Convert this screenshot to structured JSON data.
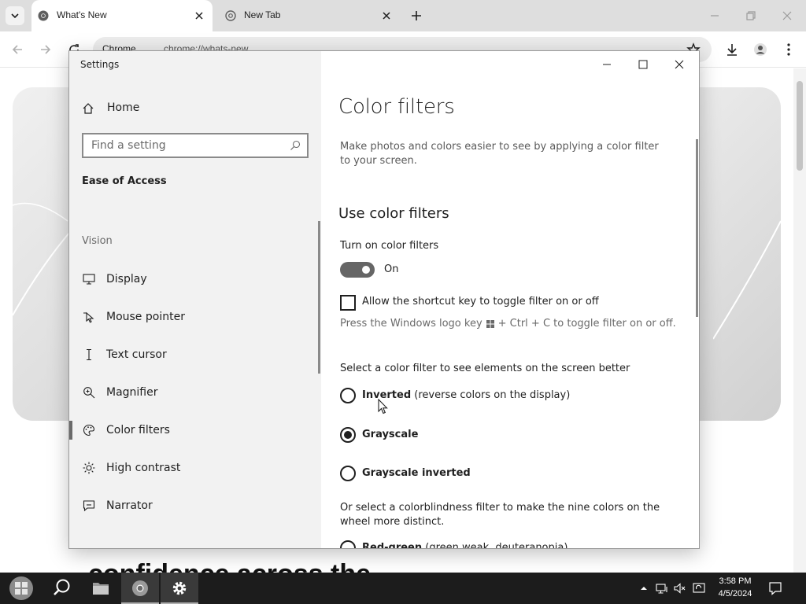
{
  "browser": {
    "tabs": [
      {
        "label": "What's New",
        "active": true,
        "icon": "chrome-icon"
      },
      {
        "label": "New Tab",
        "active": false,
        "icon": "chrome-outline-icon"
      }
    ],
    "omnibox": {
      "chip": "Chrome",
      "url": "chrome://whats-new"
    },
    "page": {
      "heading_line1": "...",
      "heading_line2": "confidence across the"
    }
  },
  "settings": {
    "window_title": "Settings",
    "home_label": "Home",
    "search_placeholder": "Find a setting",
    "section_title": "Ease of Access",
    "group_label": "Vision",
    "nav_items": [
      {
        "label": "Display",
        "icon": "monitor-icon"
      },
      {
        "label": "Mouse pointer",
        "icon": "mouse-pointer-icon"
      },
      {
        "label": "Text cursor",
        "icon": "text-cursor-icon"
      },
      {
        "label": "Magnifier",
        "icon": "magnifier-icon"
      },
      {
        "label": "Color filters",
        "icon": "palette-icon",
        "selected": true
      },
      {
        "label": "High contrast",
        "icon": "sun-icon"
      },
      {
        "label": "Narrator",
        "icon": "narrator-icon"
      }
    ],
    "content": {
      "title": "Color filters",
      "description": "Make photos and colors easier to see by applying a color filter to your screen.",
      "use_heading": "Use color filters",
      "turn_on_label": "Turn on color filters",
      "toggle_state": "On",
      "shortcut_label": "Allow the shortcut key to toggle filter on or off",
      "hint_before": "Press the Windows logo key",
      "hint_after": "+ Ctrl + C to toggle filter on or off.",
      "select_label": "Select a color filter to see elements on the screen better",
      "filters": [
        {
          "name": "Inverted",
          "note": "(reverse colors on the display)",
          "checked": false
        },
        {
          "name": "Grayscale",
          "note": "",
          "checked": true
        },
        {
          "name": "Grayscale inverted",
          "note": "",
          "checked": false
        }
      ],
      "colorblind_text": "Or select a colorblindness filter to make the nine colors on the wheel more distinct.",
      "colorblind_first": {
        "name": "Red-green",
        "note": "(green weak, deuteranopia)"
      }
    }
  },
  "taskbar": {
    "apps": [
      "file-explorer-icon",
      "chrome-icon",
      "settings-gear-icon"
    ],
    "time": "3:58 PM",
    "date": "4/5/2024"
  }
}
